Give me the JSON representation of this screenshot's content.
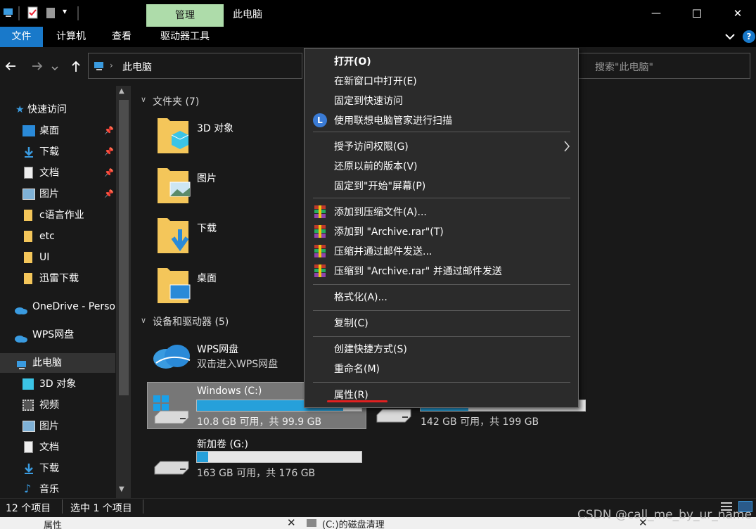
{
  "window": {
    "manage_tab": "管理",
    "title": "此电脑",
    "minimize_glyph": "—",
    "maximize_glyph": "☐",
    "close_glyph": "✕",
    "help_glyph": "?",
    "qat_dropdown_glyph": "▾"
  },
  "ribbon": {
    "tabs": [
      "文件",
      "计算机",
      "查看",
      "驱动器工具"
    ]
  },
  "address": {
    "path": "此电脑",
    "search_placeholder": "搜索\"此电脑\""
  },
  "nav": {
    "quick_access": "快速访问",
    "quick_items": [
      "桌面",
      "下载",
      "文档",
      "图片",
      "c语言作业",
      "etc",
      "UI",
      "迅雷下载"
    ],
    "onedrive": "OneDrive - Personal",
    "wps": "WPS网盘",
    "this_pc": "此电脑",
    "pc_items": [
      "3D 对象",
      "视频",
      "图片",
      "文档",
      "下载",
      "音乐"
    ]
  },
  "content": {
    "folders_header": "文件夹 (7)",
    "folders": [
      "3D 对象",
      "图片",
      "下载",
      "桌面"
    ],
    "devices_header": "设备和驱动器 (5)",
    "wps_title": "WPS网盘",
    "wps_sub": "双击进入WPS网盘",
    "drives": [
      {
        "name": "Windows (C:)",
        "free": "10.8 GB 可用，共 99.9 GB",
        "used_fraction": 0.89
      },
      {
        "name": "",
        "free": "142 GB 可用，共 199 GB",
        "used_fraction": 0.29
      },
      {
        "name": "新加卷 (G:)",
        "free": "163 GB 可用，共 176 GB",
        "used_fraction": 0.07
      }
    ]
  },
  "menu": {
    "open": "打开(O)",
    "open_new": "在新窗口中打开(E)",
    "pin_quick": "固定到快速访问",
    "lenovo_scan": "使用联想电脑管家进行扫描",
    "grant_access": "授予访问权限(G)",
    "restore_prev": "还原以前的版本(V)",
    "pin_start": "固定到\"开始\"屏幕(P)",
    "add_archive": "添加到压缩文件(A)...",
    "add_rar": "添加到 \"Archive.rar\"(T)",
    "compress_email": "压缩并通过邮件发送...",
    "compress_rar_email": "压缩到 \"Archive.rar\" 并通过邮件发送",
    "format": "格式化(A)...",
    "copy": "复制(C)",
    "create_shortcut": "创建快捷方式(S)",
    "rename": "重命名(M)",
    "properties": "属性(R)"
  },
  "status": {
    "count": "12 个项目",
    "selected": "选中 1 个项目"
  },
  "bottom": {
    "left_label": "属性",
    "right_label": "(C:)的磁盘清理",
    "watermark": "CSDN @call_me_by_ur_name"
  },
  "colors": {
    "accent": "#1979ca",
    "manage_tab": "#aedcaa",
    "progress": "#26a0da",
    "underline": "#e02020"
  }
}
